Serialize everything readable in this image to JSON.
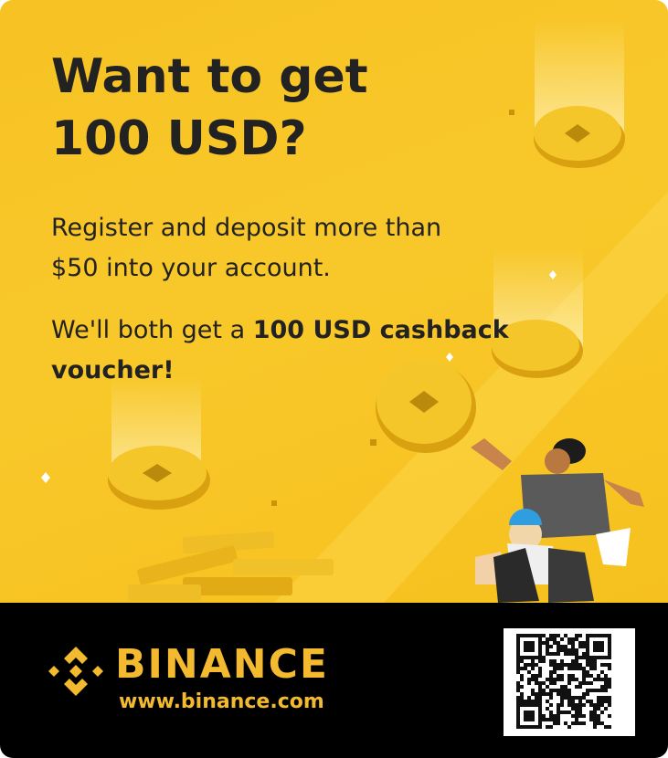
{
  "headline": {
    "line1": "Want to get",
    "line2": "100 USD?"
  },
  "paragraph1": {
    "line1": "Register and deposit more than",
    "line2": "$50 into your account."
  },
  "paragraph2": {
    "prefix": "We'll both get a ",
    "bold": "100 USD cashback",
    "bold_line2": "voucher!"
  },
  "footer": {
    "brand": "BINANCE",
    "url": "www.binance.com"
  },
  "colors": {
    "background": "#f7c223",
    "text": "#222222",
    "footer_bg": "#000000",
    "brand": "#f3ba2f"
  },
  "icons": [
    "binance-logo-icon",
    "coin-icon",
    "qr-code"
  ]
}
